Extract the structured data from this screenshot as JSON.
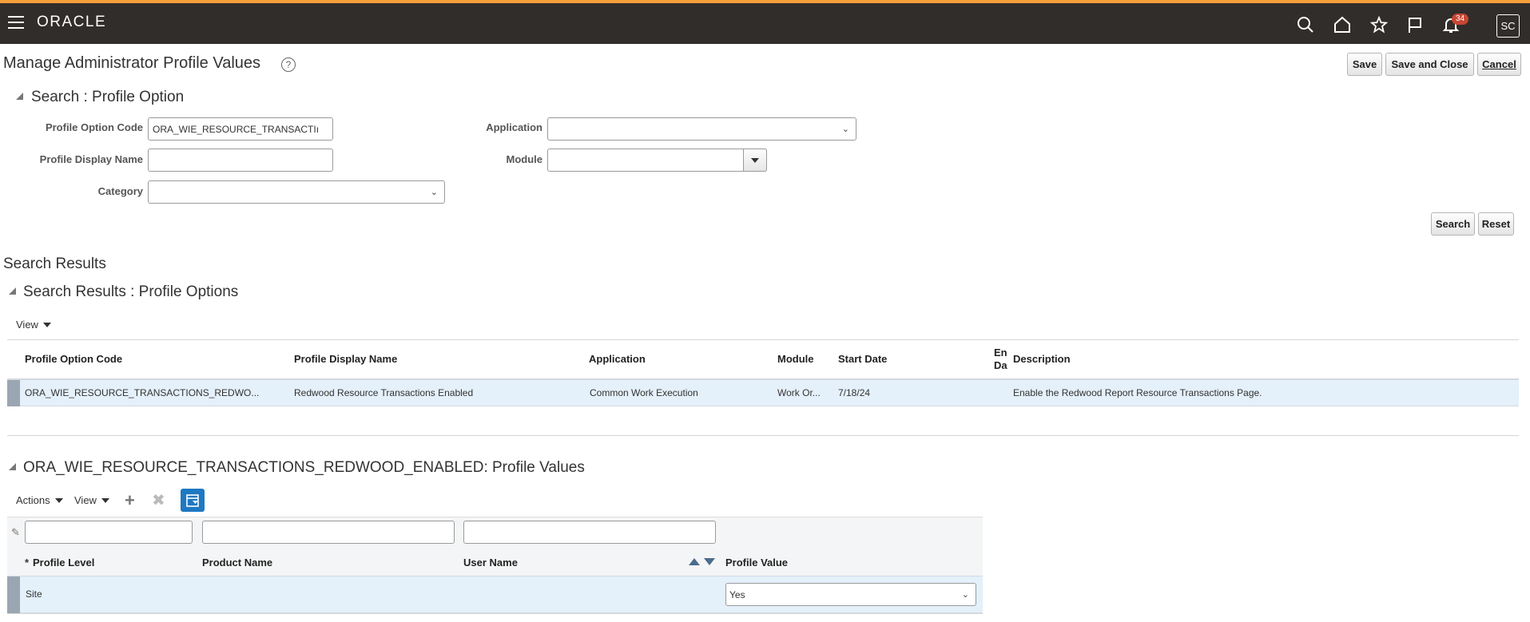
{
  "header": {
    "logo": "ORACLE",
    "notification_count": "34",
    "avatar_initials": "SC"
  },
  "page": {
    "title": "Manage Administrator Profile Values",
    "help": "?",
    "buttons": {
      "save": "Save",
      "save_close": "Save and Close",
      "cancel": "Cancel"
    }
  },
  "search": {
    "title": "Search : Profile Option",
    "fields": {
      "profile_option_code": {
        "label": "Profile Option Code",
        "value": "ORA_WIE_RESOURCE_TRANSACTIı"
      },
      "profile_display_name": {
        "label": "Profile Display Name",
        "value": ""
      },
      "category": {
        "label": "Category",
        "value": ""
      },
      "application": {
        "label": "Application",
        "value": ""
      },
      "module": {
        "label": "Module",
        "value": ""
      }
    },
    "buttons": {
      "search": "Search",
      "reset": "Reset"
    }
  },
  "results": {
    "heading": "Search Results",
    "title": "Search Results : Profile Options",
    "view_label": "View",
    "columns": {
      "code": "Profile Option Code",
      "display": "Profile Display Name",
      "application": "Application",
      "module": "Module",
      "start_date": "Start Date",
      "end_date_a": "En",
      "end_date_b": "Da",
      "description": "Description"
    },
    "rows": [
      {
        "code": "ORA_WIE_RESOURCE_TRANSACTIONS_REDWO...",
        "display": "Redwood Resource Transactions Enabled",
        "application": "Common Work Execution",
        "module": "Work Or...",
        "start_date": "7/18/24",
        "end_date": "",
        "description": "Enable the Redwood Report Resource Transactions Page."
      }
    ]
  },
  "values": {
    "title": "ORA_WIE_RESOURCE_TRANSACTIONS_REDWOOD_ENABLED: Profile Values",
    "actions_label": "Actions",
    "view_label": "View",
    "columns": {
      "required_mark": "*",
      "level": "Profile Level",
      "product": "Product Name",
      "user": "User Name",
      "value": "Profile Value"
    },
    "rows": [
      {
        "level": "Site",
        "product": "",
        "user": "",
        "value": "Yes"
      }
    ]
  },
  "colors": {
    "topbar": "#312d2a",
    "accent": "#f59f3a",
    "badge": "#c74634",
    "selected_row": "#e4f0fa",
    "toolbar_active": "#1e78c2"
  }
}
